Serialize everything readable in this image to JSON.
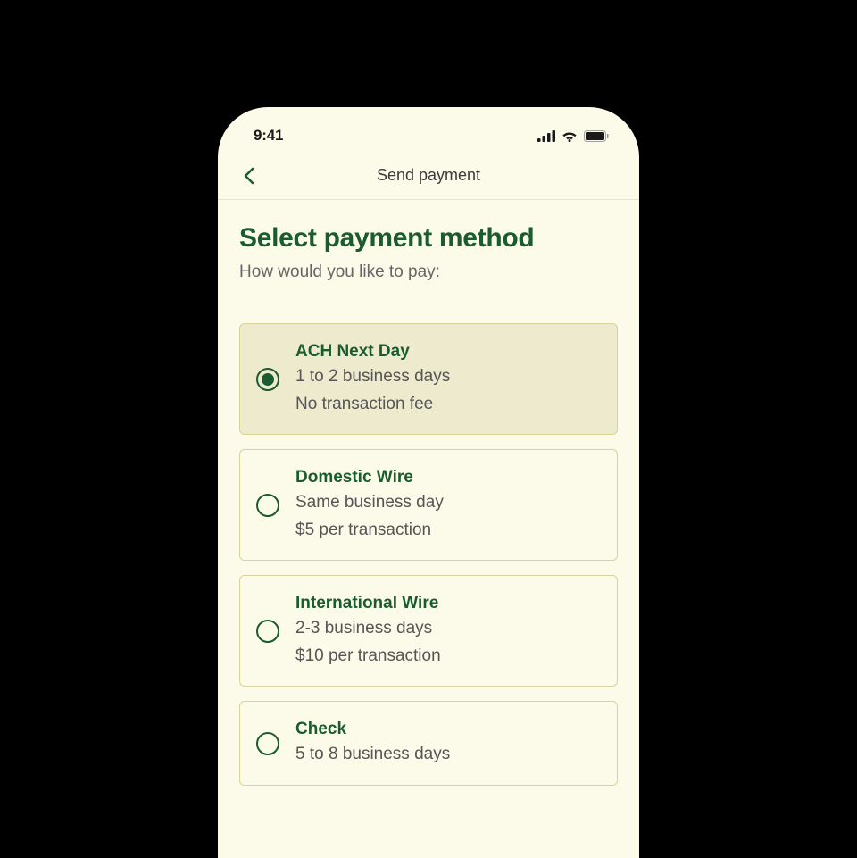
{
  "status_bar": {
    "time": "9:41"
  },
  "nav": {
    "title": "Send payment"
  },
  "page": {
    "title": "Select payment method",
    "subtitle": "How would you like to pay:"
  },
  "options": [
    {
      "title": "ACH Next Day",
      "line1": "1 to 2 business days",
      "line2": "No transaction fee",
      "selected": true
    },
    {
      "title": "Domestic Wire",
      "line1": "Same business day",
      "line2": "$5 per transaction",
      "selected": false
    },
    {
      "title": "International Wire",
      "line1": "2-3 business days",
      "line2": "$10 per transaction",
      "selected": false
    },
    {
      "title": "Check",
      "line1": "5 to 8 business days",
      "line2": "",
      "selected": false
    }
  ]
}
